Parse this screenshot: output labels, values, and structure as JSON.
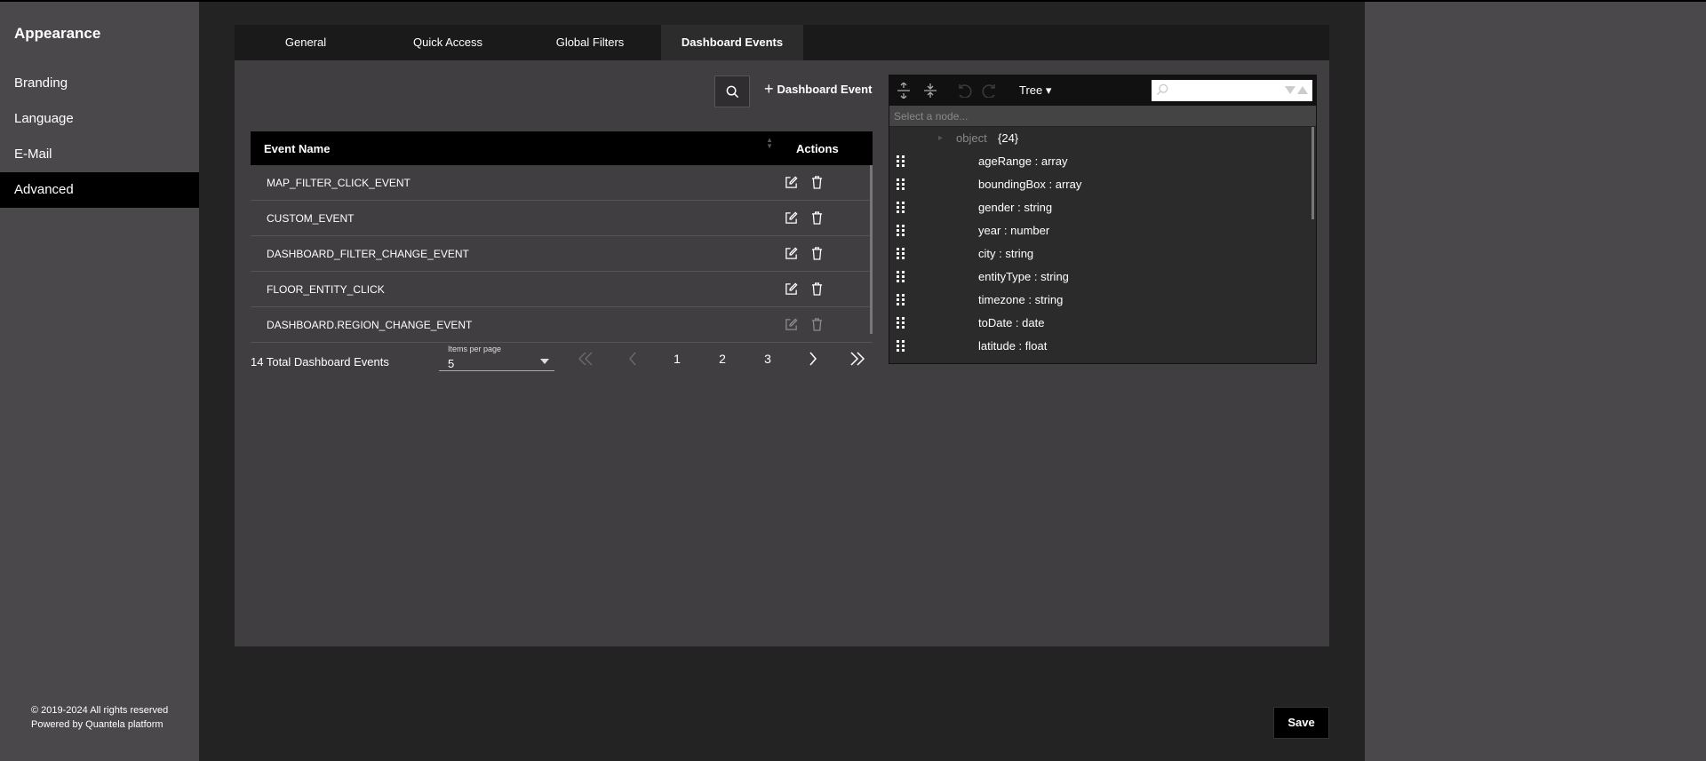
{
  "sidebar": {
    "title": "Appearance",
    "items": [
      {
        "label": "Branding"
      },
      {
        "label": "Language"
      },
      {
        "label": "E-Mail"
      },
      {
        "label": "Advanced"
      }
    ],
    "active_index": 3,
    "footer_line1": "© 2019-2024 All rights reserved",
    "footer_line2": "Powered by Quantela platform"
  },
  "tabs": [
    {
      "label": "General"
    },
    {
      "label": "Quick Access"
    },
    {
      "label": "Global Filters"
    },
    {
      "label": "Dashboard Events"
    }
  ],
  "active_tab": "Dashboard Events",
  "toolbar": {
    "search_icon": "search-icon",
    "add_label": "Dashboard Event"
  },
  "table": {
    "headers": {
      "name": "Event Name",
      "actions": "Actions"
    },
    "rows": [
      {
        "name": "MAP_FILTER_CLICK_EVENT"
      },
      {
        "name": "CUSTOM_EVENT"
      },
      {
        "name": "DASHBOARD_FILTER_CHANGE_EVENT"
      },
      {
        "name": "FLOOR_ENTITY_CLICK"
      },
      {
        "name": "DASHBOARD.REGION_CHANGE_EVENT"
      }
    ]
  },
  "pagination": {
    "total_label": "14 Total Dashboard Events",
    "items_per_page_label": "Items per page",
    "items_per_page_value": "5",
    "pages": [
      "1",
      "2",
      "3"
    ],
    "current_page": "1"
  },
  "json_editor": {
    "mode_label": "Tree ▾",
    "nav_placeholder": "Select a node...",
    "root_label": "object",
    "root_count": "{24}",
    "fields": [
      {
        "key": "ageRange",
        "type": "array"
      },
      {
        "key": "boundingBox",
        "type": "array"
      },
      {
        "key": "gender",
        "type": "string"
      },
      {
        "key": "year",
        "type": "number"
      },
      {
        "key": "city ",
        "type": "string"
      },
      {
        "key": "entityType",
        "type": "string"
      },
      {
        "key": "timezone",
        "type": "string"
      },
      {
        "key": "toDate",
        "type": "date"
      },
      {
        "key": "latitude",
        "type": "float"
      }
    ]
  },
  "save_label": "Save"
}
